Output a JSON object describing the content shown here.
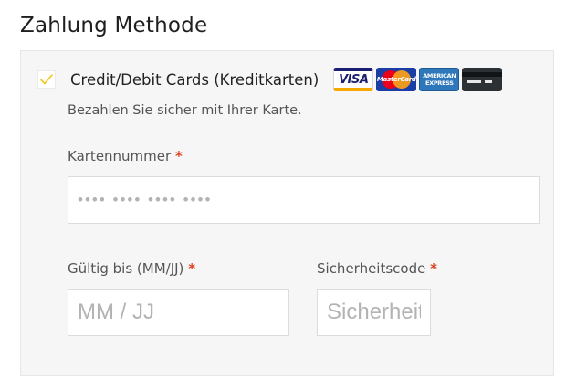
{
  "section": {
    "title": "Zahlung Methode"
  },
  "payment_method": {
    "label": "Credit/Debit Cards (Kreditkarten)",
    "checked": true,
    "description": "Bezahlen Sie sicher mit Ihrer Karte.",
    "checkbox_color": "#f5c518",
    "card_logos": [
      {
        "icon": "visa-logo-icon",
        "text": "VISA"
      },
      {
        "icon": "mastercard-logo-icon",
        "text": "MasterCard"
      },
      {
        "icon": "amex-logo-icon",
        "text_top": "AMERICAN",
        "text_bottom": "EXPRESS"
      },
      {
        "icon": "generic-card-icon"
      }
    ]
  },
  "fields": {
    "card_number": {
      "label": "Kartennummer",
      "required_mark": "*",
      "placeholder": "•••• •••• •••• ••••",
      "value": ""
    },
    "expiry": {
      "label": "Gültig bis (MM/JJ)",
      "required_mark": "*",
      "placeholder": "MM / JJ",
      "value": ""
    },
    "cvc": {
      "label": "Sicherheitscode",
      "required_mark": "*",
      "placeholder": "Sicherheitscode",
      "value": ""
    }
  },
  "colors": {
    "required": "#e2401c",
    "panel_background": "#f6f6f6",
    "checkmark": "#f5c518"
  }
}
